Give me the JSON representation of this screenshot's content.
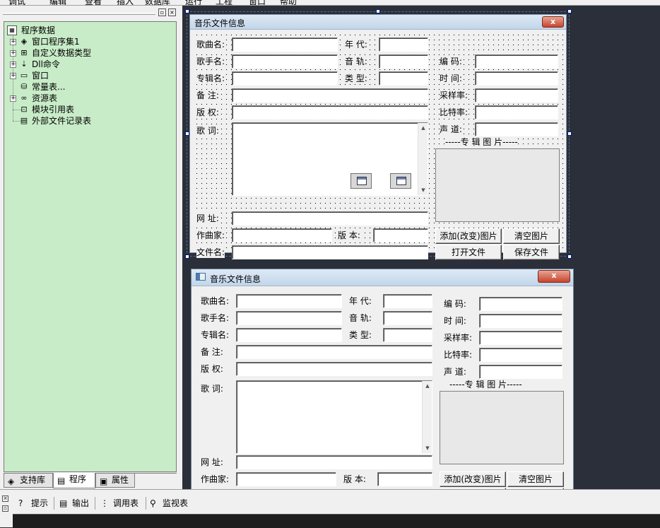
{
  "menu": [
    "调试",
    "编辑",
    "查看",
    "插入",
    "数据库",
    "运行",
    "工程",
    "窗口",
    "帮助"
  ],
  "tree": {
    "root": "程序数据",
    "items": [
      "窗口程序集1",
      "自定义数据类型",
      "Dll命令",
      "窗口",
      "常量表...",
      "资源表",
      "模块引用表",
      "外部文件记录表"
    ]
  },
  "left_tabs": [
    "支持库",
    "程序",
    "属性"
  ],
  "bottom_tabs": [
    "提示",
    "输出",
    "调用表",
    "监视表"
  ],
  "form": {
    "title": "音乐文件信息",
    "labels": {
      "song": "歌曲名:",
      "artist": "歌手名:",
      "album": "专辑名:",
      "note": "备  注:",
      "copyright": "版  权:",
      "lyrics": "歌  词:",
      "url": "网  址:",
      "composer": "作曲家:",
      "filename": "文件名:",
      "year": "年  代:",
      "track": "音  轨:",
      "genre": "类  型:",
      "version": "版  本:",
      "encoding": "编  码:",
      "time": "时  间:",
      "samplerate": "采样率:",
      "bitrate": "比特率:",
      "channel": "声  道:",
      "album_art": "-----专  辑  图  片-----"
    },
    "buttons": {
      "add_image": "添加(改变)图片",
      "clear_image": "清空图片",
      "open_file": "打开文件",
      "save_file": "保存文件"
    }
  },
  "close_glyph": "x",
  "colors": {
    "tree_bg": "#c8ecc8",
    "workspace_bg": "#2b2f39",
    "close_red": "#c8442c"
  }
}
